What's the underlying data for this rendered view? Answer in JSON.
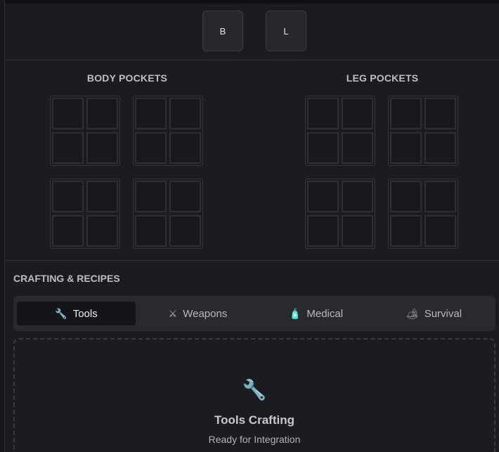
{
  "equipment": {
    "slots": [
      {
        "label": "B"
      },
      {
        "label": "L"
      }
    ]
  },
  "pockets": {
    "body_title": "BODY POCKETS",
    "leg_title": "LEG POCKETS"
  },
  "crafting": {
    "title": "CRAFTING & RECIPES",
    "tabs": [
      {
        "icon": "wrench-icon",
        "glyph": "🔧",
        "label": "Tools",
        "active": true
      },
      {
        "icon": "crossed-swords-icon",
        "glyph": "⚔",
        "label": "Weapons",
        "active": false
      },
      {
        "icon": "medicine-icon",
        "glyph": "🧴",
        "label": "Medical",
        "active": false
      },
      {
        "icon": "camping-icon",
        "glyph": "🏕",
        "label": "Survival",
        "active": false
      }
    ],
    "panel": {
      "icon": "wrench-icon",
      "glyph": "🔧",
      "title": "Tools Crafting",
      "subtitle": "Ready for Integration"
    }
  }
}
